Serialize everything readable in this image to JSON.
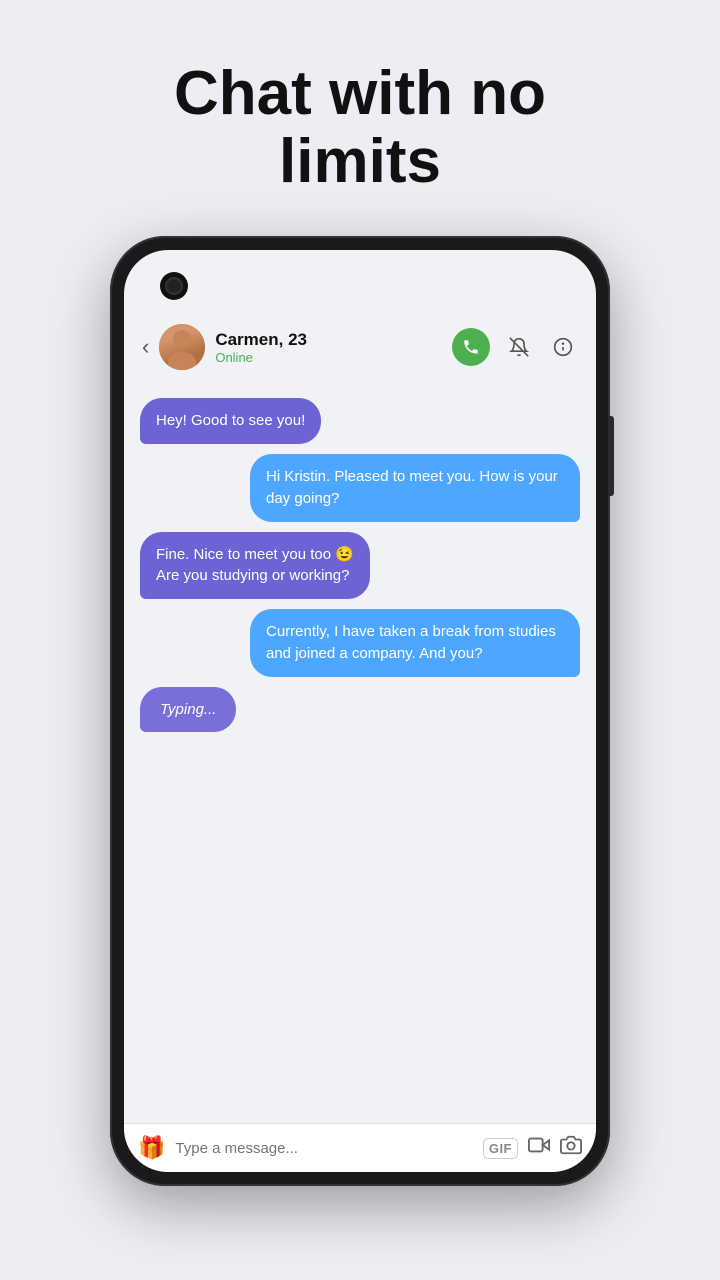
{
  "page": {
    "title_line1": "Chat with no",
    "title_line2": "limits"
  },
  "header": {
    "contact_name": "Carmen, 23",
    "contact_status": "Online",
    "back_label": "‹"
  },
  "messages": [
    {
      "id": 1,
      "side": "left",
      "text": "Hey! Good to see you!"
    },
    {
      "id": 2,
      "side": "right",
      "text": "Hi Kristin. Pleased to meet you. How is your day going?"
    },
    {
      "id": 3,
      "side": "left",
      "text": "Fine. Nice to meet you too 😉\nAre you studying or working?"
    },
    {
      "id": 4,
      "side": "right",
      "text": "Currently, I have taken a break from studies and joined a company. And you?"
    },
    {
      "id": 5,
      "side": "left",
      "typing": true,
      "text": "Typing..."
    }
  ],
  "input_bar": {
    "placeholder": "Type a message...",
    "gif_label": "GIF"
  },
  "icons": {
    "back": "‹",
    "call": "📞",
    "mute": "🔕",
    "info": "ℹ",
    "gift": "🎁",
    "video": "📹",
    "camera": "📷"
  }
}
